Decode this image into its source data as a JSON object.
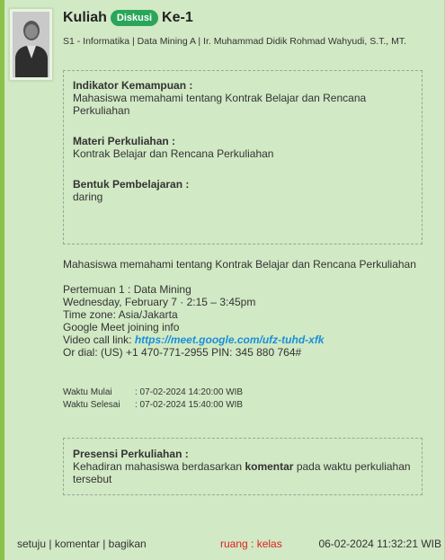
{
  "header": {
    "title_prefix": "Kuliah",
    "badge": "Diskusi",
    "title_suffix": "Ke-1",
    "subtitle": "S1 - Informatika | Data Mining A | Ir. Muhammad Didik Rohmad Wahyudi, S.T., MT."
  },
  "info_box": {
    "indikator_label": "Indikator Kemampuan :",
    "indikator_value": "Mahasiswa memahami tentang Kontrak Belajar dan Rencana Perkuliahan",
    "materi_label": "Materi Perkuliahan :",
    "materi_value": "Kontrak Belajar dan Rencana Perkuliahan",
    "bentuk_label": "Bentuk Pembelajaran :",
    "bentuk_value": "daring"
  },
  "description": {
    "summary": "Mahasiswa memahami tentang Kontrak Belajar dan Rencana Perkuliahan",
    "meeting_title": "Pertemuan 1 : Data Mining",
    "meeting_time": "Wednesday, February 7 · 2:15 – 3:45pm",
    "timezone": "Time zone: Asia/Jakarta",
    "meet_info": "Google Meet joining info",
    "video_prefix": "Video call link: ",
    "video_link": "https://meet.google.com/ufz-tuhd-xfk",
    "dial": "Or dial: (US) +1 470-771-2955 PIN: 345 880 764#"
  },
  "meta": {
    "start_label": "Waktu Mulai",
    "start_value": ": 07-02-2024 14:20:00 WIB",
    "end_label": "Waktu Selesai",
    "end_value": ": 07-02-2024 15:40:00 WIB"
  },
  "presensi": {
    "label": "Presensi Perkuliahan :",
    "text_before": "Kehadiran mahasiswa berdasarkan ",
    "text_bold": "komentar",
    "text_after": " pada waktu perkuliahan tersebut"
  },
  "footer": {
    "agree": "setuju",
    "comment": "komentar",
    "share": "bagikan",
    "sep": " | ",
    "room": "ruang : kelas",
    "timestamp": "06-02-2024 11:32:21 WIB"
  }
}
